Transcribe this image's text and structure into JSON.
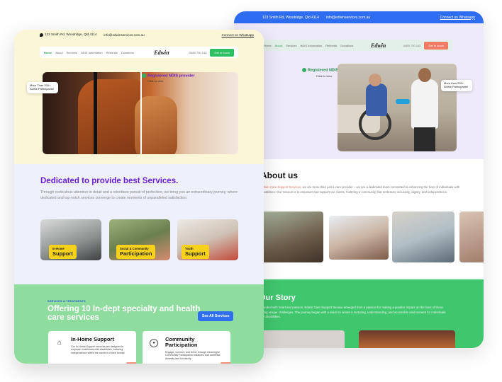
{
  "back": {
    "topbar": {
      "address": "123 Smith Rd, Woodridge, Qld 4114",
      "email": "info@edwinservices.com.au",
      "whatsapp": "Connect on Whatsapp"
    },
    "nav": {
      "items": [
        "Home",
        "About",
        "Services",
        "NDIS Information",
        "Referrals",
        "Donations"
      ],
      "active": "About",
      "logo": "Edwin",
      "phone": "0480 730 143",
      "cta": "Get in touch"
    },
    "hero": {
      "ndis": "Registered NDIS provider",
      "ndis_sub": "Click to view",
      "badge": "More than 200+ Active Participants!"
    },
    "about": {
      "title": "About us",
      "highlight": "Edwin Care Support Services,",
      "text": " we are more than just a care provider – we are a dedicated team committed to enhancing the lives of individuals with disabilities. Our mission is to empower and support our clients, fostering a community that embraces inclusivity, dignity, and independence."
    },
    "story": {
      "title": "Our Story",
      "text": "Founded with heart and passion, Edwin Care Support Service emerged from a passion for making a positive impact on the lives of those facing unique challenges. The journey began with a vision to create a nurturing, understanding, and accessible environment for individuals with disabilities."
    }
  },
  "front": {
    "topbar": {
      "address": "123 Smith Rd, Woodridge, Qld 4114",
      "email": "info@edwinservices.com.au",
      "whatsapp": "Connect on Whatsapp"
    },
    "nav": {
      "items": [
        "Home",
        "About",
        "Services",
        "NDIS Information",
        "Referrals",
        "Donations"
      ],
      "active": "Home",
      "logo": "Edwin",
      "phone": "0480 730 143",
      "cta": "Get in touch"
    },
    "hero": {
      "ndis": "Registered NDIS provider",
      "ndis_sub": "Click to view",
      "badge": "More Than 200+ Active Participants!"
    },
    "services": {
      "title": "Dedicated to provide best Services.",
      "text": "Through meticulous attention to detail and a relentless pursuit of perfection, we bring you an extraordinary journey, where dedicated and top-notch services converge to create moments of unparalleled satisfaction.",
      "cards": [
        {
          "top": "In-Home",
          "main": "Support"
        },
        {
          "top": "Social & Community",
          "main": "Participation"
        },
        {
          "top": "Youth",
          "main": "Support"
        }
      ]
    },
    "specialty": {
      "kicker": "SERVICES & TREATMENTS",
      "title": "Offering 10 In-dept specialty and health care services",
      "cta": "See All Services",
      "items": [
        {
          "title": "In-Home Support",
          "desc": "Our In-Home Support services are designed to empower individuals with disabilities, fostering independence within the comfort of their homes."
        },
        {
          "title": "Community Participation",
          "desc": "Engage, connect, and thrive through meaningful Community Participation initiatives that celebrate diversity and inclusivity."
        }
      ]
    }
  },
  "colors": {
    "back_topbar": "#2e6cf0",
    "front_hero_bg": "#faf6d7",
    "services_title": "#6a1fd0",
    "green_cta": "#2fbf63",
    "tag_yellow": "#f8d21a",
    "see_all": "#2f6ff0",
    "story_green": "#40c66d"
  }
}
